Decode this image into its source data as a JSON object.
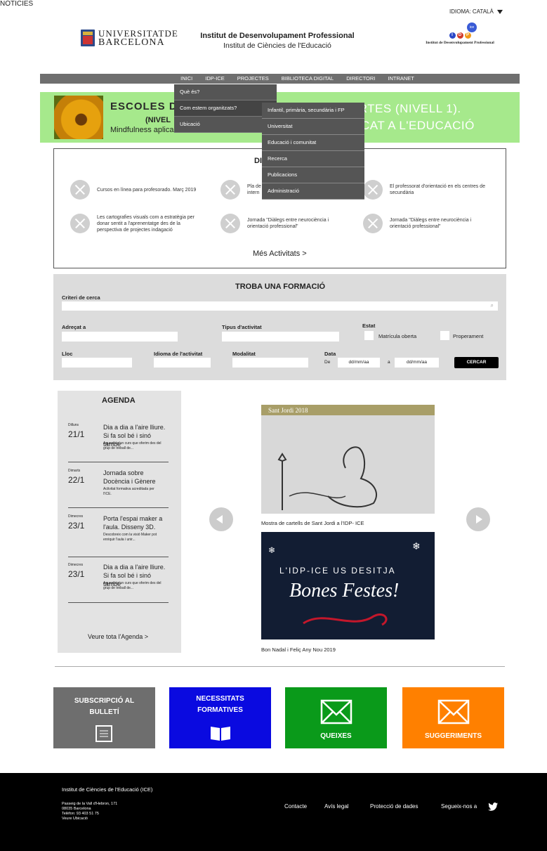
{
  "header": {
    "language": "IDIOMA: CATALÀ",
    "ub_line1": "UNIVERSITATDE",
    "ub_line2": "BARCELONA",
    "title1": "Institut de Desenvolupament Professional",
    "title2": "Institut de Ciències de l'Educació",
    "idp_logo_text": "Institut de Desenvolupament Professional",
    "ice_badge": "ice"
  },
  "nav": [
    "INICI",
    "IDP-ICE",
    "PROJECTES",
    "BIBLIOTECA DIGITAL",
    "DIRECTORI",
    "INTRANET"
  ],
  "dropdown1": [
    "Què és?",
    "Com estem organitzats?",
    "Ubicació"
  ],
  "dropdown2": [
    "Infantil, primària, secundària i FP",
    "Universitat",
    "Educació i comunitat",
    "Recerca",
    "Publicacions",
    "Administració"
  ],
  "banner": {
    "left_title": "ESCOLES DE",
    "left_sub": "(NIVEL",
    "left_line": "Mindfulness aplica",
    "right1": "PERTES (NIVELL 1).",
    "right2": "PLICAT A L'EDUCACIÓ"
  },
  "activities": {
    "title": "DI",
    "items": [
      "Cursos en línea para profesorado. Març 2019",
      "Pla de",
      "El professorat d'orientació en els centres de secundària",
      "Les cartografies visuals com a estratègia per donar sentit a l'aprenentatge des de la perspectiva de projectes indagació",
      "Jornada \"Diàlegs entre neurociència i orientació professional\"",
      "Jornada \"Diàlegs entre neurociència i orientació professional\""
    ],
    "item2_line2": "intern",
    "more": "Més Activitats >"
  },
  "search": {
    "title": "TROBA UNA FORMACIÓ",
    "criteri": "Criteri de cerca",
    "adrecat": "Adreçat a",
    "tipus": "Tipus d'activitat",
    "estat": "Estat",
    "matricula": "Matrícula oberta",
    "properament": "Properament",
    "lloc": "Lloc",
    "idioma": "Idioma de l'activitat",
    "modalitat": "Modalitat",
    "data": "Data",
    "de": "De",
    "date_placeholder": "dd/mm/aa",
    "a": "a",
    "button": "CERCAR"
  },
  "agenda": {
    "title": "AGENDA",
    "events": [
      {
        "day": "Dilluns",
        "date": "21/1",
        "title": "Dia a dia a l'aire lliure. Si fa sol bé i sinó també",
        "sub": "Aquest és un curs que oferim des del grup de treball de..."
      },
      {
        "day": "Dimarts",
        "date": "22/1",
        "title": "Jornada sobre Docència i Gènere",
        "sub": "Activitat formativa acreditada per l'ICE."
      },
      {
        "day": "Dimecres",
        "date": "23/1",
        "title": "Porta l'espai maker a l'aula. Disseny 3D.",
        "sub": "Descobreix com la visió Maker pot enriquir l'aula i unir..."
      },
      {
        "day": "Dimecres",
        "date": "23/1",
        "title": "Dia a dia a l'aire lliure. Si fa sol bé i sinó també",
        "sub": "Aquest és un curs que oferim des del grup de treball de..."
      }
    ],
    "more": "Veure tota l'Agenda >"
  },
  "news": {
    "title": "NÓTICIES",
    "img1_label": "Sant Jordi 2018",
    "caption1": "Mostra de cartells de Sant Jordi a l'IDP- ICE",
    "img2_line1": "L'IDP-ICE US DESITJA",
    "img2_line2": "Bones Festes!",
    "caption2": "Bon Nadal i Feliç Any Nou 2019"
  },
  "boxes": [
    {
      "label": "SUBSCRIPCIÓ AL BULLETÍ",
      "color": "#6e6e6e",
      "icon": "newsletter-icon"
    },
    {
      "label": "NECESSITATS FORMATIVES",
      "color": "#0a0ae0",
      "icon": "book-icon"
    },
    {
      "label": "QUEIXES",
      "color": "#0a9a1a",
      "icon": "envelope-icon"
    },
    {
      "label": "SUGGERIMENTS",
      "color": "#ff8000",
      "icon": "envelope-icon"
    }
  ],
  "footer": {
    "org": "Institut de Ciències de l'Educació (ICE)",
    "addr1": "Passeig de la Vall d'Hebron, 171",
    "addr2": "08035 Barcelona",
    "addr3": "Telèfon: 93 403 51 75",
    "addr4": "Veure Ubicació",
    "contacte": "Contacte",
    "avis": "Avís legal",
    "proteccio": "Protecció de dades",
    "segueix": "Segueix-nos a"
  }
}
